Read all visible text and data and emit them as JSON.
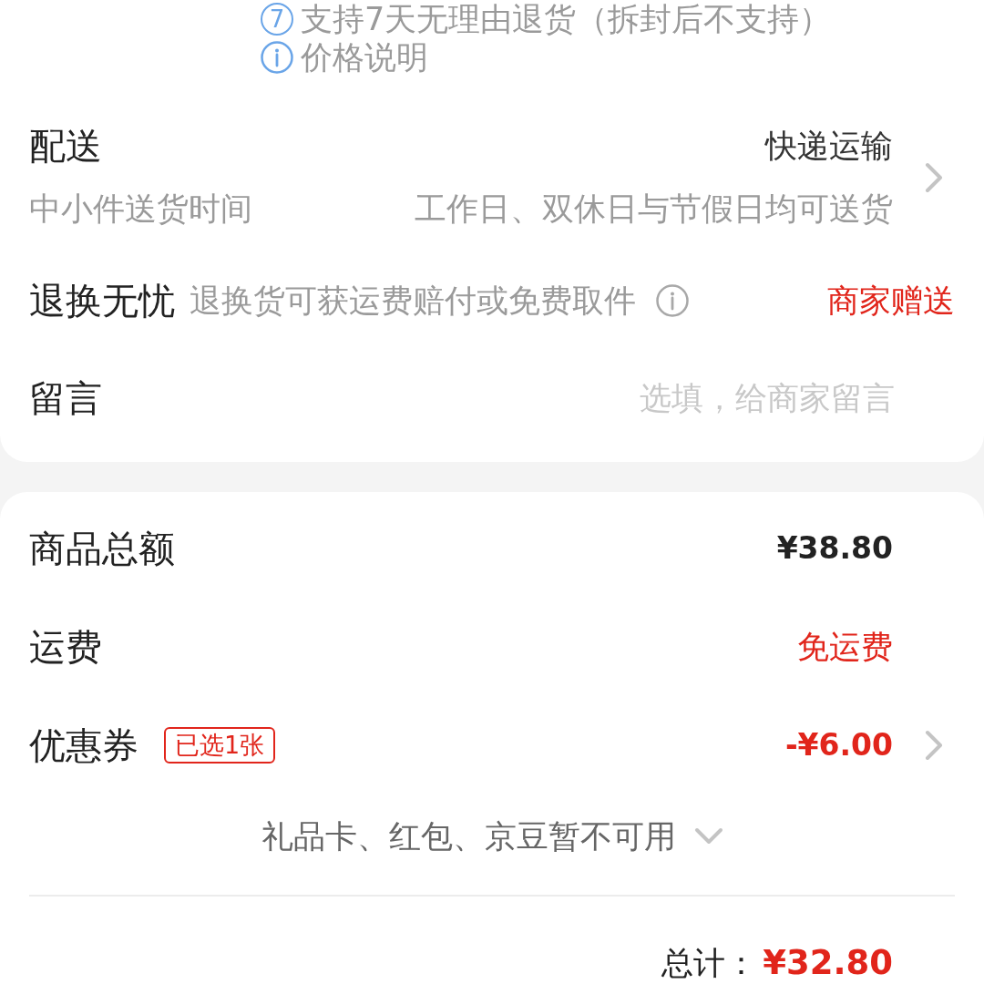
{
  "service_notes": [
    {
      "kind": "days",
      "badge": "7",
      "text": "支持7天无理由退货（拆封后不支持）"
    },
    {
      "kind": "info",
      "text": "价格说明"
    }
  ],
  "delivery": {
    "label": "配送",
    "method": "快递运输",
    "time_label": "中小件送货时间",
    "time_value": "工作日、双休日与节假日均可送货"
  },
  "return_service": {
    "label": "退换无忧",
    "description": "退换货可获运费赔付或免费取件",
    "value": "商家赠送"
  },
  "message": {
    "label": "留言",
    "placeholder": "选填，给商家留言"
  },
  "summary": {
    "rows": [
      {
        "kind": "amount",
        "label": "商品总额",
        "value": "¥38.80",
        "highlight": false,
        "has_detail": false
      },
      {
        "kind": "text",
        "label": "运费",
        "value": "免运费",
        "highlight": true,
        "has_detail": false
      },
      {
        "kind": "amount",
        "label": "优惠券",
        "badge": "已选1张",
        "value": "-¥6.00",
        "highlight": true,
        "has_detail": true
      }
    ],
    "unavailable_note": "礼品卡、红包、京豆暂不可用",
    "total_label": "总计：",
    "total_value": "¥32.80"
  }
}
